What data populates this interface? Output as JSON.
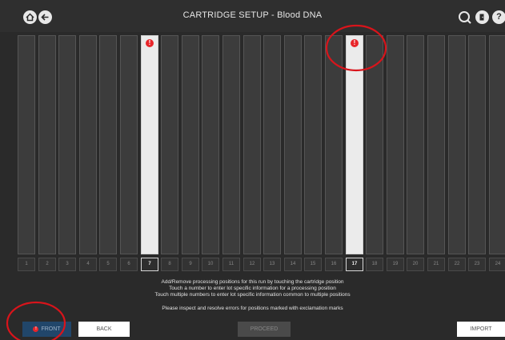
{
  "header": {
    "title": "CARTRIDGE SETUP - Blood DNA",
    "icons": [
      "home-icon",
      "back-arrow-icon",
      "search-refresh-icon",
      "logout-icon",
      "help-icon"
    ]
  },
  "positions": [
    {
      "number": "1",
      "active": false,
      "error": false
    },
    {
      "number": "2",
      "active": false,
      "error": false
    },
    {
      "number": "3",
      "active": false,
      "error": false
    },
    {
      "number": "4",
      "active": false,
      "error": false
    },
    {
      "number": "5",
      "active": false,
      "error": false
    },
    {
      "number": "6",
      "active": false,
      "error": false
    },
    {
      "number": "7",
      "active": true,
      "error": true
    },
    {
      "number": "8",
      "active": false,
      "error": false
    },
    {
      "number": "9",
      "active": false,
      "error": false
    },
    {
      "number": "10",
      "active": false,
      "error": false
    },
    {
      "number": "11",
      "active": false,
      "error": false
    },
    {
      "number": "12",
      "active": false,
      "error": false
    },
    {
      "number": "13",
      "active": false,
      "error": false
    },
    {
      "number": "14",
      "active": false,
      "error": false
    },
    {
      "number": "15",
      "active": false,
      "error": false
    },
    {
      "number": "16",
      "active": false,
      "error": false
    },
    {
      "number": "17",
      "active": true,
      "error": true
    },
    {
      "number": "18",
      "active": false,
      "error": false
    },
    {
      "number": "19",
      "active": false,
      "error": false
    },
    {
      "number": "20",
      "active": false,
      "error": false
    },
    {
      "number": "21",
      "active": false,
      "error": false
    },
    {
      "number": "22",
      "active": false,
      "error": false
    },
    {
      "number": "23",
      "active": false,
      "error": false
    },
    {
      "number": "24",
      "active": false,
      "error": false
    }
  ],
  "error_marker": "!",
  "instructions": {
    "line1": "Add/Remove processing positions for this run by touching the cartridge position",
    "line2": "Touch a number to enter lot specific information for a processing position",
    "line3": "Touch multiple numbers to enter lot specific information common to multiple positions",
    "warning": "Please inspect and resolve errors for positions marked with exclamation marks"
  },
  "buttons": {
    "front": "FRONT",
    "front_badge": "!",
    "back": "BACK",
    "proceed": "PROCEED",
    "import": "IMPORT"
  },
  "colors": {
    "background": "#2a2a2a",
    "slot_inactive": "#3c3c3c",
    "slot_active": "#ebebeb",
    "error": "#e8252a",
    "front_button": "#21466a",
    "annotation": "#d9141b"
  }
}
